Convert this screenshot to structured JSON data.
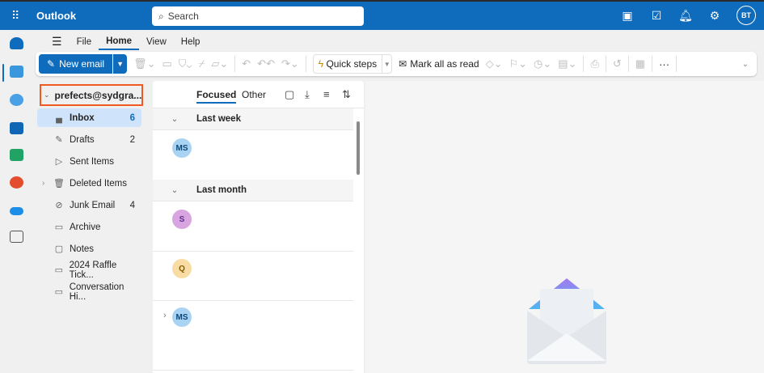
{
  "app": {
    "title": "Outlook",
    "search_placeholder": "Search",
    "user_initials": "BT"
  },
  "header_icons": [
    "onenote-icon",
    "todo-icon",
    "bell-icon",
    "gear-icon"
  ],
  "ribbon": {
    "tabs": [
      "File",
      "Home",
      "View",
      "Help"
    ],
    "active_tab": "Home",
    "new_email": "New email",
    "quick_steps": "Quick steps",
    "mark_all_read": "Mark all as read"
  },
  "folders": {
    "account": "prefects@sydgra...",
    "items": [
      {
        "label": "Inbox",
        "count": "6",
        "icon": "inbox"
      },
      {
        "label": "Drafts",
        "count": "2",
        "icon": "pencil"
      },
      {
        "label": "Sent Items",
        "count": "",
        "icon": "send"
      },
      {
        "label": "Deleted Items",
        "count": "",
        "icon": "trash"
      },
      {
        "label": "Junk Email",
        "count": "4",
        "icon": "junk"
      },
      {
        "label": "Archive",
        "count": "",
        "icon": "archive"
      },
      {
        "label": "Notes",
        "count": "",
        "icon": "note"
      },
      {
        "label": "2024 Raffle Tick...",
        "count": "",
        "icon": "folder"
      },
      {
        "label": "Conversation Hi...",
        "count": "",
        "icon": "folder"
      }
    ]
  },
  "list": {
    "tabs": {
      "focused": "Focused",
      "other": "Other"
    },
    "groups": [
      {
        "label": "Last week"
      },
      {
        "label": "Last month"
      }
    ],
    "messages": [
      {
        "initials": "MS",
        "color": "#a9d3f2",
        "text": "#0e4775"
      },
      {
        "initials": "S",
        "color": "#d8a5e0",
        "text": "#5c2e91"
      },
      {
        "initials": "Q",
        "color": "#f9dca4",
        "text": "#835b00"
      },
      {
        "initials": "MS",
        "color": "#a9d3f2",
        "text": "#0e4775"
      }
    ]
  },
  "colors": {
    "brand": "#0f6cbd",
    "highlight": "#f05a22"
  }
}
